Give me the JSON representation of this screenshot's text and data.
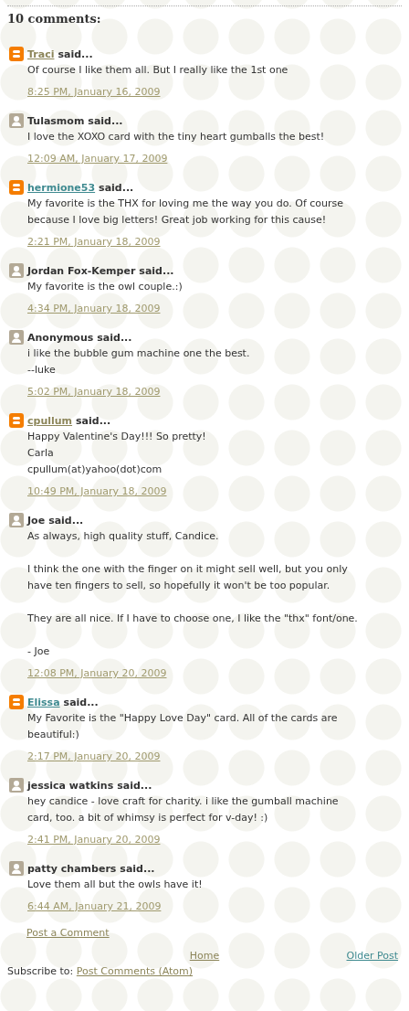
{
  "heading": "10 comments:",
  "comments": [
    {
      "kind": "blogger",
      "author": "Traci",
      "visited": true,
      "said": "said...",
      "paragraphs": [
        [
          "Of course I like them all. But I really like the 1st one"
        ]
      ],
      "time": "8:25 PM, January 16, 2009"
    },
    {
      "kind": "anonymous",
      "author": "Tulasmom",
      "said": "said...",
      "paragraphs": [
        [
          "I love the XOXO card with the tiny heart gumballs the best!"
        ]
      ],
      "time": "12:09 AM, January 17, 2009"
    },
    {
      "kind": "blogger",
      "author": "hermione53",
      "visited": false,
      "said": "said...",
      "paragraphs": [
        [
          "My favorite is the THX for loving me the way you do. Of course",
          "because I love big letters! Great job working for this cause!"
        ]
      ],
      "time": "2:21 PM, January 18, 2009"
    },
    {
      "kind": "anonymous",
      "author": "Jordan Fox-Kemper",
      "said": "said...",
      "paragraphs": [
        [
          "My favorite is the owl couple.:)"
        ]
      ],
      "time": "4:34 PM, January 18, 2009"
    },
    {
      "kind": "anonymous",
      "author": "Anonymous",
      "said": "said...",
      "paragraphs": [
        [
          "i like the bubble gum machine one the best.",
          "--luke"
        ]
      ],
      "time": "5:02 PM, January 18, 2009"
    },
    {
      "kind": "blogger",
      "author": "cpullum",
      "visited": true,
      "said": "said...",
      "paragraphs": [
        [
          "Happy Valentine's Day!!! So pretty!",
          "Carla",
          "cpullum(at)yahoo(dot)com"
        ]
      ],
      "time": "10:49 PM, January 18, 2009"
    },
    {
      "kind": "anonymous",
      "author": "Joe",
      "said": "said...",
      "paragraphs": [
        [
          "As always, high quality stuff, Candice."
        ],
        [
          "I think the one with the finger on it might sell well, but you only",
          "have ten fingers to sell, so hopefully it won't be too popular."
        ],
        [
          "They are all nice. If I have to choose one, I like the \"thx\" font/one."
        ],
        [
          "- Joe"
        ]
      ],
      "time": "12:08 PM, January 20, 2009"
    },
    {
      "kind": "blogger",
      "author": "Elissa",
      "visited": false,
      "said": "said...",
      "paragraphs": [
        [
          "My Favorite is the \"Happy Love Day\" card. All of the cards are",
          "beautiful:)"
        ]
      ],
      "time": "2:17 PM, January 20, 2009"
    },
    {
      "kind": "anonymous",
      "author": "jessica watkins",
      "said": "said...",
      "paragraphs": [
        [
          "hey candice - love craft for charity. i like the gumball machine",
          "card, too. a bit of whimsy is perfect for v-day! :)"
        ]
      ],
      "time": "2:41 PM, January 20, 2009"
    },
    {
      "kind": "anonymous",
      "author": "patty chambers",
      "said": "said...",
      "paragraphs": [
        [
          "Love them all but the owls have it!"
        ]
      ],
      "time": "6:44 AM, January 21, 2009"
    }
  ],
  "post_comment": {
    "label": "Post a Comment",
    "visited": true
  },
  "nav": {
    "home": {
      "label": "Home",
      "visited": true
    },
    "older": {
      "label": "Older Post",
      "visited": false
    }
  },
  "subscribe": {
    "label": "Subscribe to:",
    "link": {
      "label": "Post Comments (Atom)",
      "visited": true
    }
  }
}
